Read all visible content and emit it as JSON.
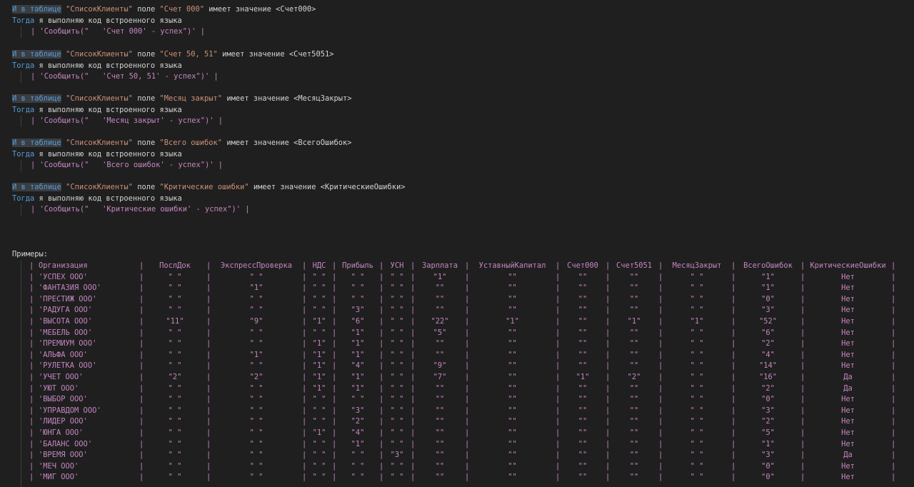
{
  "blocks": [
    {
      "and_kw": "И в таблице",
      "table_name": "\"СписокКлиенты\"",
      "field_word": "поле",
      "field_name": "\"Счет 000\"",
      "value_text": "имеет значение <Счет000>",
      "then_kw": "Тогда",
      "then_text": "я выполняю код встроенного языка",
      "code": "| 'Сообщить(\"   'Счет 000' - успех\")' |"
    },
    {
      "and_kw": "И в таблице",
      "table_name": "\"СписокКлиенты\"",
      "field_word": "поле",
      "field_name": "\"Счет 50, 51\"",
      "value_text": "имеет значение <Счет5051>",
      "then_kw": "Тогда",
      "then_text": "я выполняю код встроенного языка",
      "code": "| 'Сообщить(\"   'Счет 50, 51' - успех\")' |"
    },
    {
      "and_kw": "И в таблице",
      "table_name": "\"СписокКлиенты\"",
      "field_word": "поле",
      "field_name": "\"Месяц закрыт\"",
      "value_text": "имеет значение <МесяцЗакрыт>",
      "then_kw": "Тогда",
      "then_text": "я выполняю код встроенного языка",
      "code": "| 'Сообщить(\"   'Месяц закрыт' - успех\")' |"
    },
    {
      "and_kw": "И в таблице",
      "table_name": "\"СписокКлиенты\"",
      "field_word": "поле",
      "field_name": "\"Всего ошибок\"",
      "value_text": "имеет значение <ВсегоОшибок>",
      "then_kw": "Тогда",
      "then_text": "я выполняю код встроенного языка",
      "code": "| 'Сообщить(\"   'Всего ошибок' - успех\")' |"
    },
    {
      "and_kw": "И в таблице",
      "table_name": "\"СписокКлиенты\"",
      "field_word": "поле",
      "field_name": "\"Критические ошибки\"",
      "value_text": "имеет значение <КритическиеОшибки>",
      "then_kw": "Тогда",
      "then_text": "я выполняю код встроенного языка",
      "code": "| 'Сообщить(\"   'Критические ошибки' - успех\")' |"
    }
  ],
  "examples_label": "Примеры:",
  "examples": {
    "headers": [
      "Организация",
      "ПослДок",
      "ЭкспрессПроверка",
      "НДС",
      "Прибыль",
      "УСН",
      "Зарплата",
      "УставныйКапитал",
      "Счет000",
      "Счет5051",
      "МесяцЗакрыт",
      "ВсегоОшибок",
      "КритическиеОшибки"
    ],
    "rows": [
      [
        "'УСПЕХ ООО'",
        "\" \"",
        "\" \"",
        "\" \"",
        "\" \"",
        "\" \"",
        "\"1\"",
        "\"\"",
        "\"\"",
        "\"\"",
        "\" \"",
        "\"1\"",
        "Нет"
      ],
      [
        "'ФАНТАЗИЯ ООО'",
        "\" \"",
        "\"1\"",
        "\" \"",
        "\" \"",
        "\" \"",
        "\"\"",
        "\"\"",
        "\"\"",
        "\"\"",
        "\" \"",
        "\"1\"",
        "Нет"
      ],
      [
        "'ПРЕСТИЖ ООО'",
        "\" \"",
        "\" \"",
        "\" \"",
        "\" \"",
        "\" \"",
        "\"\"",
        "\"\"",
        "\"\"",
        "\"\"",
        "\" \"",
        "\"0\"",
        "Нет"
      ],
      [
        "'РАДУГА ООО'",
        "\" \"",
        "\" \"",
        "\" \"",
        "\"3\"",
        "\" \"",
        "\"\"",
        "\"\"",
        "\"\"",
        "\"\"",
        "\" \"",
        "\"3\"",
        "Нет"
      ],
      [
        "'ВЫСОТА ООО'",
        "\"11\"",
        "\"9\"",
        "\"1\"",
        "\"6\"",
        "\" \"",
        "\"22\"",
        "\"1\"",
        "\"\"",
        "\"1\"",
        "\"1\"",
        "\"52\"",
        "Нет"
      ],
      [
        "'МЕБЕЛЬ ООО'",
        "\" \"",
        "\" \"",
        "\" \"",
        "\"1\"",
        "\" \"",
        "\"5\"",
        "\"\"",
        "\"\"",
        "\"\"",
        "\" \"",
        "\"6\"",
        "Нет"
      ],
      [
        "'ПРЕМИУМ ООО'",
        "\" \"",
        "\" \"",
        "\"1\"",
        "\"1\"",
        "\" \"",
        "\"\"",
        "\"\"",
        "\"\"",
        "\"\"",
        "\" \"",
        "\"2\"",
        "Нет"
      ],
      [
        "'АЛЬФА ООО'",
        "\" \"",
        "\"1\"",
        "\"1\"",
        "\"1\"",
        "\" \"",
        "\"\"",
        "\"\"",
        "\"\"",
        "\"\"",
        "\" \"",
        "\"4\"",
        "Нет"
      ],
      [
        "'РУЛЕТКА ООО'",
        "\" \"",
        "\" \"",
        "\"1\"",
        "\"4\"",
        "\" \"",
        "\"9\"",
        "\"\"",
        "\"\"",
        "\"\"",
        "\" \"",
        "\"14\"",
        "Нет"
      ],
      [
        "'УЧЕТ ООО'",
        "\"2\"",
        "\"2\"",
        "\"1\"",
        "\"1\"",
        "\" \"",
        "\"7\"",
        "\"\"",
        "\"1\"",
        "\"2\"",
        "\" \"",
        "\"16\"",
        "Да"
      ],
      [
        "'УЮТ ООО'",
        "\" \"",
        "\" \"",
        "\"1\"",
        "\"1\"",
        "\" \"",
        "\"\"",
        "\"\"",
        "\"\"",
        "\"\"",
        "\" \"",
        "\"2\"",
        "Да"
      ],
      [
        "'ВЫБОР ООО'",
        "\" \"",
        "\" \"",
        "\" \"",
        "\" \"",
        "\" \"",
        "\"\"",
        "\"\"",
        "\"\"",
        "\"\"",
        "\" \"",
        "\"0\"",
        "Нет"
      ],
      [
        "'УПРАВДОМ ООО'",
        "\" \"",
        "\" \"",
        "\" \"",
        "\"3\"",
        "\" \"",
        "\"\"",
        "\"\"",
        "\"\"",
        "\"\"",
        "\" \"",
        "\"3\"",
        "Нет"
      ],
      [
        "'ЛИДЕР ООО'",
        "\" \"",
        "\" \"",
        "\" \"",
        "\"2\"",
        "\" \"",
        "\"\"",
        "\"\"",
        "\"\"",
        "\"\"",
        "\" \"",
        "\"2\"",
        "Нет"
      ],
      [
        "'ЮНГА ООО'",
        "\" \"",
        "\" \"",
        "\"1\"",
        "\"4\"",
        "\" \"",
        "\"\"",
        "\"\"",
        "\"\"",
        "\"\"",
        "\" \"",
        "\"5\"",
        "Нет"
      ],
      [
        "'БАЛАНС ООО'",
        "\" \"",
        "\" \"",
        "\" \"",
        "\"1\"",
        "\" \"",
        "\"\"",
        "\"\"",
        "\"\"",
        "\"\"",
        "\" \"",
        "\"1\"",
        "Нет"
      ],
      [
        "'ВРЕМЯ ООО'",
        "\" \"",
        "\" \"",
        "\" \"",
        "\" \"",
        "\"3\"",
        "\"\"",
        "\"\"",
        "\"\"",
        "\"\"",
        "\" \"",
        "\"3\"",
        "Да"
      ],
      [
        "'МЕЧ ООО'",
        "\" \"",
        "\" \"",
        "\" \"",
        "\" \"",
        "\" \"",
        "\"\"",
        "\"\"",
        "\"\"",
        "\"\"",
        "\" \"",
        "\"0\"",
        "Нет"
      ],
      [
        "'МИГ ООО'",
        "\" \"",
        "\" \"",
        "\" \"",
        "\" \"",
        "\" \"",
        "\"\"",
        "\"\"",
        "\"\"",
        "\"\"",
        "\" \"",
        "\"0\"",
        "Нет"
      ]
    ]
  },
  "colors": {
    "background": "#1f1f1f",
    "keyword": "#569cd6",
    "string": "#ce9178",
    "code": "#c586c0",
    "plain": "#d4d4d4"
  }
}
